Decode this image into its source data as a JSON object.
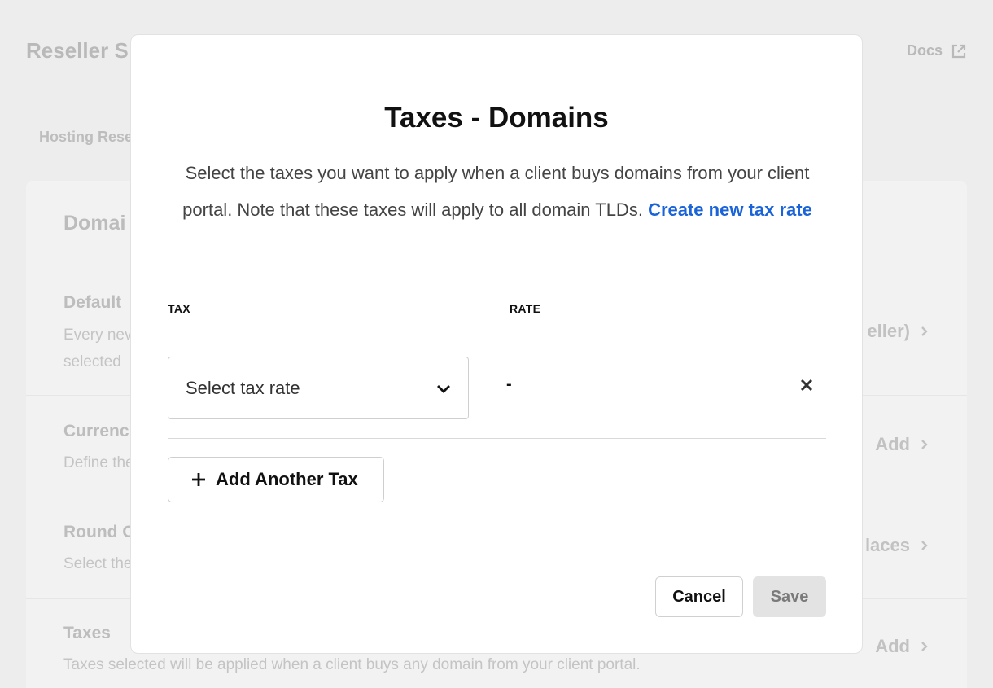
{
  "background": {
    "title": "Reseller S",
    "docs_label": "Docs",
    "breadcrumb": "Hosting Rese",
    "card_title": "Domai",
    "rows": [
      {
        "title": "Default",
        "desc_line1": "Every nev",
        "desc_line2": "selected",
        "action": "eller)"
      },
      {
        "title": "Currenc",
        "desc_line1": "Define the",
        "desc_line2": "",
        "action": "Add"
      },
      {
        "title": "Round O",
        "desc_line1": "Select the",
        "desc_line2": "",
        "action": "laces"
      },
      {
        "title": "Taxes",
        "desc_line1": "Taxes selected will be applied when a client buys any domain from your client portal.",
        "desc_line2": "",
        "action": "Add"
      }
    ]
  },
  "modal": {
    "title": "Taxes - Domains",
    "description": "Select the taxes you want to apply when a client buys domains from your client portal. Note that these taxes will apply to all domain TLDs.",
    "create_link": "Create new tax rate",
    "columns": {
      "tax": "TAX",
      "rate": "RATE"
    },
    "row": {
      "select_placeholder": "Select tax rate",
      "rate": "-"
    },
    "add_button": "Add Another Tax",
    "cancel_button": "Cancel",
    "save_button": "Save"
  },
  "colors": {
    "link": "#1a63d8",
    "save_disabled_bg": "#e3e3e3"
  }
}
